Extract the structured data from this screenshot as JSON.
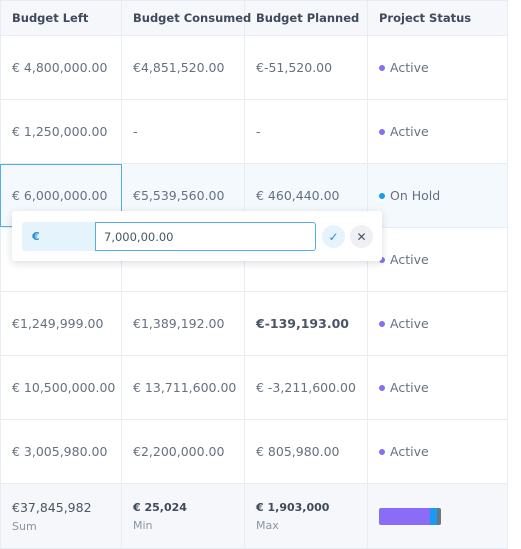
{
  "columns": [
    "Budget Left",
    "Budget Consumed",
    "Budget Planned",
    "Project Status"
  ],
  "status_colors": {
    "Active": "#8b6cf6",
    "On Hold": "#1a9bf0",
    "Other": "#6b7685"
  },
  "rows": [
    {
      "budget_left": "€ 4,800,000.00",
      "budget_consumed": "€4,851,520.00",
      "budget_planned": "€-51,520.00",
      "status": "Active"
    },
    {
      "budget_left": "€ 1,250,000.00",
      "budget_consumed": "-",
      "budget_planned": "-",
      "status": "Active"
    },
    {
      "budget_left": "€ 6,000,000.00",
      "budget_consumed": "€5,539,560.00",
      "budget_planned": "€ 460,440.00",
      "status": "On Hold"
    },
    {
      "budget_left": "",
      "budget_consumed": "",
      "budget_planned": "",
      "status": "Active"
    },
    {
      "budget_left": "€1,249,999.00",
      "budget_consumed": "€1,389,192.00",
      "budget_planned": "€-139,193.00",
      "status": "Active"
    },
    {
      "budget_left": "€ 10,500,000.00",
      "budget_consumed": "€ 13,711,600.00",
      "budget_planned": "€ -3,211,600.00",
      "status": "Active"
    },
    {
      "budget_left": "€ 3,005,980.00",
      "budget_consumed": "€2,200,000.00",
      "budget_planned": "€ 805,980.00",
      "status": "Active"
    }
  ],
  "footer": {
    "sum_value": "€37,845,982",
    "sum_label": "Sum",
    "min_value": "€ 25,024",
    "min_label": "Min",
    "max_value": "€ 1,903,000",
    "max_label": "Max",
    "status_distribution": [
      {
        "label": "Active",
        "fraction": 0.82,
        "color": "#8b6cf6"
      },
      {
        "label": "On Hold",
        "fraction": 0.11,
        "color": "#1a9bf0"
      },
      {
        "label": "Other",
        "fraction": 0.07,
        "color": "#6b7685"
      }
    ]
  },
  "editor": {
    "currency_prefix": "€",
    "value": "7,000,00.00",
    "confirm_icon": "check-icon",
    "cancel_icon": "close-icon"
  }
}
